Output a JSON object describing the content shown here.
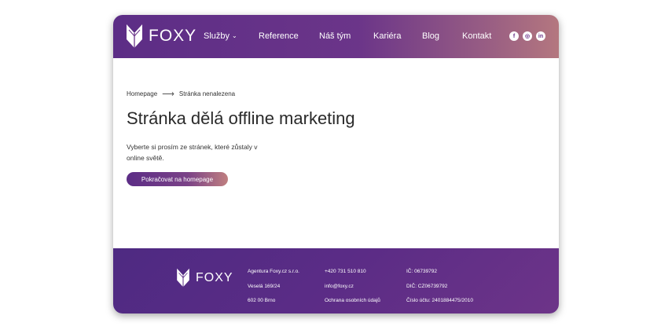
{
  "header": {
    "logo_text": "FOXY",
    "nav": [
      {
        "label": "Služby",
        "has_dropdown": true
      },
      {
        "label": "Reference"
      },
      {
        "label": "Náš tým"
      },
      {
        "label": "Kariéra"
      },
      {
        "label": "Blog"
      },
      {
        "label": "Kontakt"
      }
    ],
    "social": [
      {
        "icon": "facebook-icon",
        "glyph": "f"
      },
      {
        "icon": "instagram-icon",
        "glyph": "◎"
      },
      {
        "icon": "linkedin-icon",
        "glyph": "in"
      }
    ]
  },
  "main": {
    "breadcrumb": {
      "home": "Homepage",
      "current": "Stránka nenalezena"
    },
    "title": "Stránka dělá offline marketing",
    "description": "Vyberte si prosím ze stránek, které zůstaly v online světě.",
    "cta_label": "Pokračovat na homepage"
  },
  "footer": {
    "logo_text": "FOXY",
    "col1": [
      "Agentura Foxy.cz s.r.o.",
      "Veselá 169/24",
      "602 00 Brno"
    ],
    "col2": [
      "+420 731 510 810",
      "info@foxy.cz",
      "Ochrana osobních údajů"
    ],
    "col3": [
      "IČ: 06739792",
      "DIČ: CZ06739792",
      "Číslo účtu: 2401884475/2010"
    ]
  },
  "colors": {
    "brand_purple": "#5c2d86",
    "brand_pink": "#b4777f"
  }
}
